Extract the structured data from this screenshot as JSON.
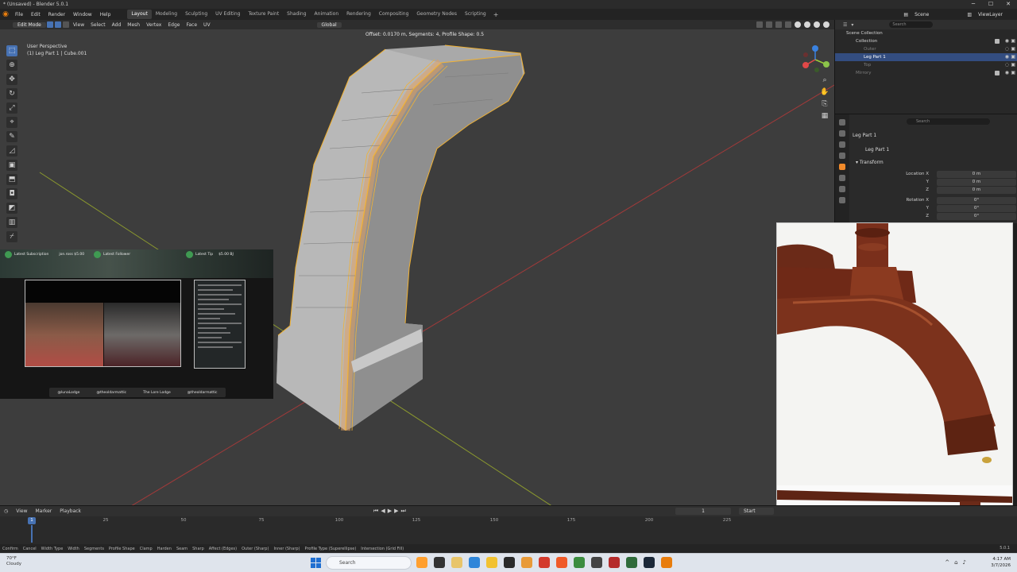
{
  "window": {
    "title": "* (Unsaved) - Blender 5.0.1",
    "min": "─",
    "max": "☐",
    "close": "✕"
  },
  "menus": [
    "File",
    "Edit",
    "Render",
    "Window",
    "Help"
  ],
  "workspaces": [
    "Layout",
    "Modeling",
    "Sculpting",
    "UV Editing",
    "Texture Paint",
    "Shading",
    "Animation",
    "Rendering",
    "Compositing",
    "Geometry Nodes",
    "Scripting"
  ],
  "top_right": {
    "scene": "Scene",
    "view_layer": "ViewLayer"
  },
  "viewport": {
    "mode": "Edit Mode",
    "header_menus": [
      "View",
      "Select",
      "Add",
      "Mesh",
      "Vertex",
      "Edge",
      "Face",
      "UV"
    ],
    "orientation": "Global",
    "operator_text": "Offset: 0.0170 m, Segments: 4, Profile Shape: 0.5",
    "view_name": "User Perspective",
    "object_name": "(1) Leg Part 1 | Cube.001",
    "gizmo": {
      "x": "X",
      "y": "Y",
      "z": "Z"
    }
  },
  "toolbar_icons": [
    "select-box-icon",
    "cursor-icon",
    "move-icon",
    "rotate-icon",
    "scale-icon",
    "transform-icon",
    "annotate-icon",
    "measure-icon",
    "add-cube-icon",
    "extrude-icon",
    "inset-icon",
    "bevel-icon",
    "loop-cut-icon",
    "knife-icon",
    "poly-build-icon",
    "spin-icon",
    "smooth-icon",
    "shrink-icon",
    "shear-icon",
    "rip-icon"
  ],
  "overlay": {
    "goals": [
      "Latest Subscription",
      "Latest Follower",
      "Latest Tip"
    ],
    "goal_values": [
      "jon.ross $5.00",
      "",
      "$5.00 BJ"
    ],
    "socials": [
      "@lunaLodge",
      "@theoldarmattic",
      "The Lore Lodge",
      "@theoldarmattic"
    ]
  },
  "outliner": {
    "search_placeholder": "Search",
    "rows": [
      {
        "label": "Scene Collection",
        "indent": 0,
        "state": "normal"
      },
      {
        "label": "Collection",
        "indent": 1,
        "state": "normal"
      },
      {
        "label": "Outer",
        "indent": 2,
        "state": "dim"
      },
      {
        "label": "Leg Part 1",
        "indent": 2,
        "state": "active"
      },
      {
        "label": "Top",
        "indent": 2,
        "state": "dim"
      },
      {
        "label": "Mirrory",
        "indent": 1,
        "state": "dim"
      }
    ]
  },
  "properties": {
    "search_placeholder": "Search",
    "object_label": "Leg Part 1",
    "object_field": "Leg Part 1",
    "section": "Transform",
    "fields": [
      {
        "label": "Location X",
        "value": "0 m"
      },
      {
        "label": "Y",
        "value": "0 m"
      },
      {
        "label": "Z",
        "value": "0 m"
      },
      {
        "label": "Rotation X",
        "value": "0°"
      },
      {
        "label": "Y",
        "value": "0°"
      },
      {
        "label": "Z",
        "value": "0°"
      }
    ]
  },
  "timeline": {
    "menus": [
      "View",
      "Marker",
      "Playback"
    ],
    "current_frame": "1",
    "start_label": "Start",
    "ticks": [
      "25",
      "50",
      "75",
      "100",
      "125",
      "150",
      "175",
      "200",
      "225"
    ],
    "cursor_label": "1"
  },
  "statusbar": {
    "items": [
      "Confirm",
      "Cancel",
      "Width Type",
      "Width",
      "Segments",
      "Profile Shape",
      "Clamp",
      "Harden",
      "Seam",
      "Sharp",
      "Affect (Edges)",
      "Outer (Sharp)",
      "Inner (Sharp)",
      "Profile Type (Superellipse)",
      "Intersection (Grid Fill)"
    ],
    "version": "5.0.1"
  },
  "taskbar": {
    "temperature": "70°F",
    "weather": "Cloudy",
    "search_placeholder": "Search",
    "time": "4:17 AM",
    "date": "3/7/2026"
  }
}
